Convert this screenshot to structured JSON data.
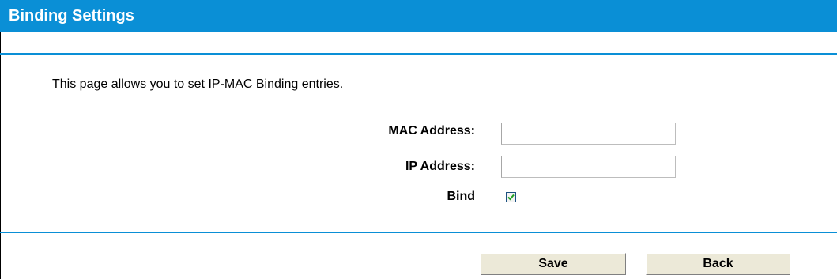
{
  "header": {
    "title": "Binding Settings"
  },
  "intro": "This page allows you to set IP-MAC Binding entries.",
  "form": {
    "mac_label": "MAC Address:",
    "mac_value": "",
    "ip_label": "IP Address:",
    "ip_value": "",
    "bind_label": "Bind",
    "bind_checked": true
  },
  "buttons": {
    "save": "Save",
    "back": "Back"
  },
  "colors": {
    "accent": "#0a8fd6"
  }
}
